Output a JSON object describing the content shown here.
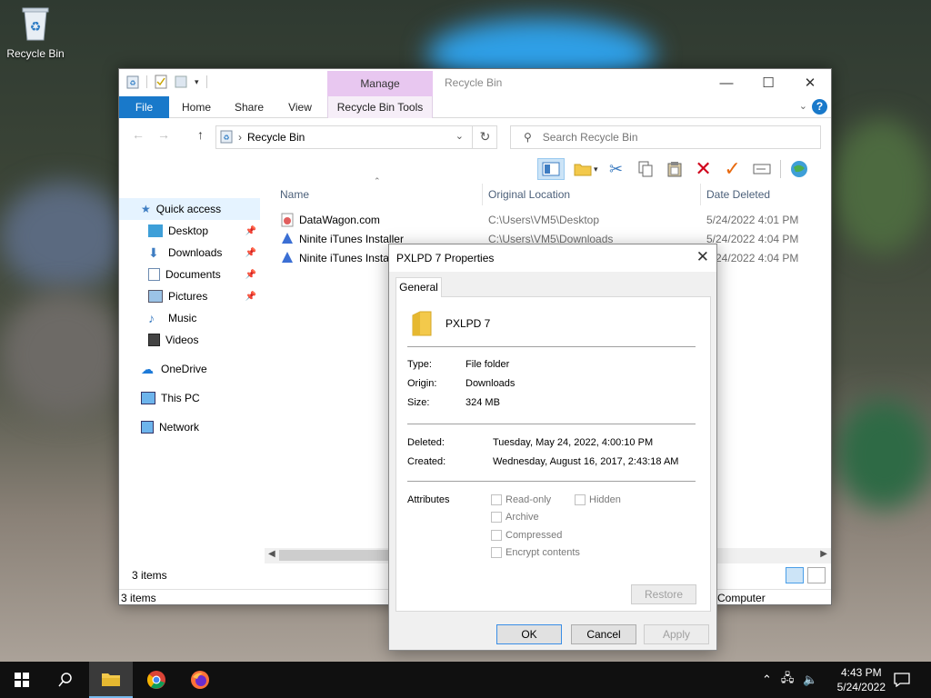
{
  "desktop": {
    "recycle_bin_label": "Recycle Bin"
  },
  "window": {
    "title": "Recycle Bin",
    "contextual_group": "Manage",
    "tabs": {
      "file": "File",
      "home": "Home",
      "share": "Share",
      "view": "View",
      "tools": "Recycle Bin Tools"
    },
    "breadcrumb": "Recycle Bin",
    "search_placeholder": "Search Recycle Bin"
  },
  "nav": {
    "quick_access": "Quick access",
    "desktop": "Desktop",
    "downloads": "Downloads",
    "documents": "Documents",
    "pictures": "Pictures",
    "music": "Music",
    "videos": "Videos",
    "onedrive": "OneDrive",
    "this_pc": "This PC",
    "network": "Network"
  },
  "list": {
    "columns": {
      "name": "Name",
      "origin": "Original Location",
      "deleted": "Date Deleted"
    },
    "rows": [
      {
        "name": "DataWagon.com",
        "origin": "C:\\Users\\VM5\\Desktop",
        "deleted": "5/24/2022 4:01 PM"
      },
      {
        "name": "Ninite iTunes Installer",
        "origin": "C:\\Users\\VM5\\Downloads",
        "deleted": "5/24/2022 4:04 PM"
      },
      {
        "name": "Ninite iTunes Installer",
        "origin": "",
        "deleted": "5/24/2022 4:04 PM"
      }
    ]
  },
  "status": {
    "items_top": "3 items",
    "items_bottom": "3 items",
    "computer": "Computer"
  },
  "dialog": {
    "title": "PXLPD 7 Properties",
    "tab": "General",
    "name": "PXLPD 7",
    "type_label": "Type:",
    "type_value": "File folder",
    "origin_label": "Origin:",
    "origin_value": "Downloads",
    "size_label": "Size:",
    "size_value": "324 MB",
    "deleted_label": "Deleted:",
    "deleted_value": "Tuesday, May 24, 2022, 4:00:10 PM",
    "created_label": "Created:",
    "created_value": "Wednesday, August 16, 2017, 2:43:18 AM",
    "attributes_label": "Attributes",
    "attr_readonly": "Read-only",
    "attr_hidden": "Hidden",
    "attr_archive": "Archive",
    "attr_compressed": "Compressed",
    "attr_encrypt": "Encrypt contents",
    "restore": "Restore",
    "ok": "OK",
    "cancel": "Cancel",
    "apply": "Apply"
  },
  "taskbar": {
    "time": "4:43 PM",
    "date": "5/24/2022"
  },
  "colors": {
    "accent": "#1979ca",
    "manage": "#e8c7f0",
    "taskbar": "#101010"
  }
}
